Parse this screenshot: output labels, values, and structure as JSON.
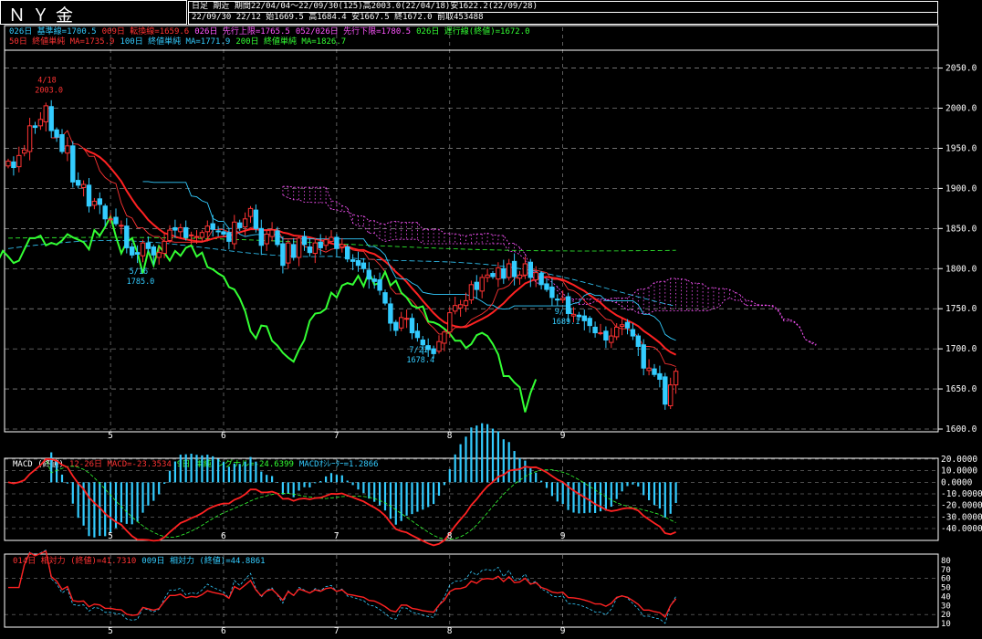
{
  "header": {
    "title": "ＮＹ金",
    "info1": "日足 期近 期間22/04/04～22/09/30(125)高2003.0(22/04/18)安1622.2(22/09/28)",
    "info2": "22/09/30 22/12 始1669.5 高1684.4 安1667.5 終1672.0 前取453488"
  },
  "legend_main": [
    {
      "text": "026日 基準線=1700.5",
      "color": "#33ccff"
    },
    {
      "text": "009日 転換線=1659.6",
      "color": "#ff3333"
    },
    {
      "text": "026日 先行上限=1765.5",
      "color": "#ff55ff"
    },
    {
      "text": "052/026日 先行下限=1780.5",
      "color": "#ff55ff"
    },
    {
      "text": "026日 遅行線(終値)=1672.0",
      "color": "#33ff33"
    }
  ],
  "legend_ma": [
    {
      "text": "50日 終値単純 MA=1735.9",
      "color": "#ff3333"
    },
    {
      "text": "100日 終値単純 MA=1771.9",
      "color": "#33ccff"
    },
    {
      "text": "200日 終値単純 MA=1826.7",
      "color": "#33ff33"
    }
  ],
  "legend_macd": [
    {
      "text": "MACD (終値)",
      "color": "#ffffff"
    },
    {
      "text": "12-26日 MACD=-23.3534",
      "color": "#ff3333"
    },
    {
      "text": "9日 単純 シグナル=-24.6399",
      "color": "#33ff33"
    },
    {
      "text": "MACDｵｼﾚｰﾀｰ=1.2866",
      "color": "#33ccff"
    }
  ],
  "legend_rsi": [
    {
      "text": "014日 相対力 (終値)=41.7310",
      "color": "#ff3333"
    },
    {
      "text": "009日 相対力 (終値)=44.8861",
      "color": "#33ccff"
    }
  ],
  "chart_data": [
    {
      "type": "candlestick",
      "panel": "price",
      "y_ticks": [
        "2050.0",
        "2000.0",
        "1950.0",
        "1900.0",
        "1850.0",
        "1800.0",
        "1750.0",
        "1700.0",
        "1650.0",
        "1600.0"
      ],
      "ylim": [
        1600,
        2070
      ],
      "x_ticks": [
        "5",
        "6",
        "7",
        "8",
        "9"
      ],
      "x_tick_index": [
        19,
        40,
        61,
        82,
        103
      ],
      "n_bars": 125,
      "close": [
        1934,
        1926,
        1941,
        1948,
        1978,
        1976,
        1986,
        2003,
        1972,
        1964,
        1946,
        1953,
        1908,
        1904,
        1905,
        1878,
        1884,
        1880,
        1862,
        1862,
        1856,
        1854,
        1826,
        1817,
        1818,
        1832,
        1825,
        1817,
        1820,
        1834,
        1848,
        1848,
        1851,
        1839,
        1842,
        1840,
        1845,
        1853,
        1849,
        1846,
        1843,
        1834,
        1858,
        1851,
        1862,
        1875,
        1850,
        1829,
        1843,
        1848,
        1830,
        1804,
        1832,
        1814,
        1838,
        1830,
        1820,
        1832,
        1826,
        1836,
        1839,
        1825,
        1830,
        1812,
        1809,
        1804,
        1800,
        1787,
        1784,
        1773,
        1757,
        1732,
        1723,
        1739,
        1738,
        1720,
        1714,
        1705,
        1699,
        1694,
        1709,
        1721,
        1745,
        1754,
        1755,
        1760,
        1780,
        1774,
        1789,
        1792,
        1790,
        1801,
        1788,
        1806,
        1790,
        1792,
        1806,
        1789,
        1795,
        1780,
        1774,
        1764,
        1761,
        1763,
        1744,
        1743,
        1740,
        1735,
        1729,
        1720,
        1720,
        1711,
        1716,
        1727,
        1730,
        1726,
        1716,
        1703,
        1676,
        1676,
        1668,
        1662,
        1631,
        1655,
        1672
      ],
      "annotations": [
        {
          "label": "4/18",
          "value": "2003.0",
          "index": 7,
          "color": "#ff3333",
          "position": "above"
        },
        {
          "label": "5/16",
          "value": "1785.0",
          "index": 24,
          "color": "#33ccff",
          "position": "below"
        },
        {
          "label": "7/21",
          "value": "1678.4",
          "index": 76,
          "color": "#33ccff",
          "position": "below"
        },
        {
          "label": "9/ 1",
          "value": "1689.1",
          "index": 103,
          "color": "#33ccff",
          "position": "below"
        }
      ]
    },
    {
      "type": "bar-line",
      "panel": "macd",
      "y_ticks": [
        "20.0000",
        "10.0000",
        "0.0000",
        "-10.0000",
        "-20.0000",
        "-30.0000",
        "-40.0000"
      ],
      "ylim": [
        -40,
        20
      ]
    },
    {
      "type": "line",
      "panel": "rsi",
      "y_ticks": [
        "80",
        "70",
        "60",
        "50",
        "40",
        "30",
        "20",
        "10"
      ],
      "ylim": [
        10,
        80
      ]
    }
  ]
}
